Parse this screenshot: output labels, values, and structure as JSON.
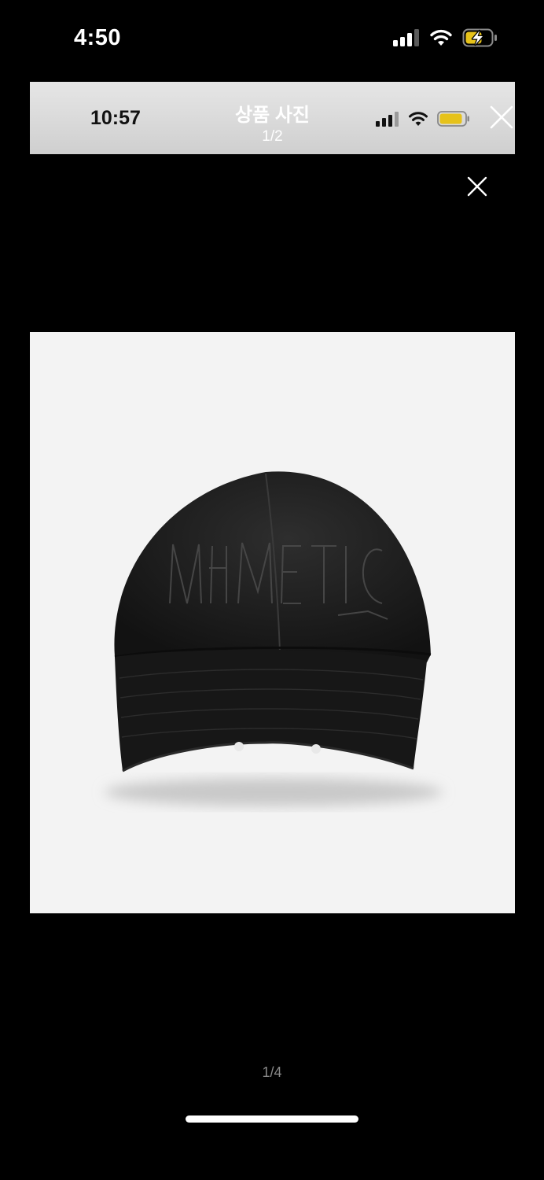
{
  "status_bar": {
    "time": "4:50",
    "icons": [
      "signal-icon",
      "wifi-icon",
      "battery-charging-icon"
    ]
  },
  "inner_screenshot": {
    "time": "10:57",
    "title": "상품 사진",
    "counter": "1/2",
    "icons": [
      "signal-icon",
      "wifi-icon",
      "battery-icon",
      "close-icon"
    ]
  },
  "viewer": {
    "close_icon": "close-icon",
    "page_indicator": "1/4"
  },
  "colors": {
    "background": "#000000",
    "image_background": "#f3f3f3",
    "battery_fill": "#e6c21a",
    "page_indicator": "#8a8a8a"
  }
}
